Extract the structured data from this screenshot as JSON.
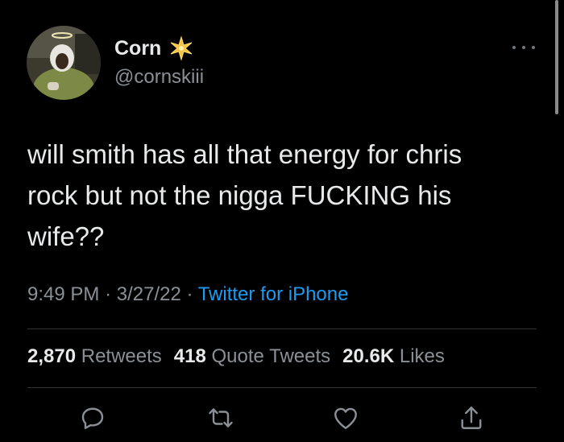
{
  "user": {
    "display_name": "Corn",
    "handle": "@cornskiii",
    "badge_icon": "sparkle-emoji",
    "avatar_icon": "avatar-photo"
  },
  "tweet": {
    "text": "will smith has all that energy for chris\nrock but not the nigga FUCKING his\nwife??",
    "time": "9:49 PM",
    "date": "3/27/22",
    "separator": "·",
    "source": "Twitter for iPhone"
  },
  "stats": [
    {
      "count": "2,870",
      "label": "Retweets"
    },
    {
      "count": "418",
      "label": "Quote Tweets"
    },
    {
      "count": "20.6K",
      "label": "Likes"
    }
  ],
  "actions": [
    "reply-icon",
    "retweet-icon",
    "like-icon",
    "share-icon"
  ],
  "colors": {
    "background": "#000000",
    "text": "#e7e9ea",
    "secondary": "#8b9096",
    "link": "#1d9bf0",
    "divider": "#2f3336"
  }
}
